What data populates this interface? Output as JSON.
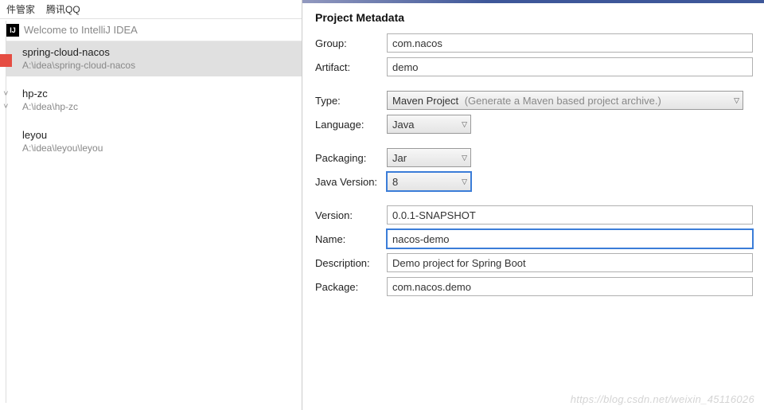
{
  "os_titlebar": {
    "item1": "件管家",
    "item2": "腾讯QQ"
  },
  "welcome": {
    "icon_text": "IJ",
    "title": "Welcome to IntelliJ IDEA"
  },
  "projects": [
    {
      "name": "spring-cloud-nacos",
      "path": "A:\\idea\\spring-cloud-nacos",
      "selected": true
    },
    {
      "name": "hp-zc",
      "path": "A:\\idea\\hp-zc",
      "selected": false
    },
    {
      "name": "leyou",
      "path": "A:\\idea\\leyou\\leyou",
      "selected": false
    }
  ],
  "sidebar_stub": {
    "text1": ">",
    "text2": ">"
  },
  "metadata": {
    "section_title": "Project Metadata",
    "labels": {
      "group": "Group:",
      "artifact": "Artifact:",
      "type": "Type:",
      "language": "Language:",
      "packaging": "Packaging:",
      "javaVersion": "Java Version:",
      "version": "Version:",
      "name": "Name:",
      "description": "Description:",
      "pkg": "Package:"
    },
    "values": {
      "group": "com.nacos",
      "artifact": "demo",
      "type": "Maven Project",
      "type_hint": "(Generate a Maven based project archive.)",
      "language": "Java",
      "packaging": "Jar",
      "javaVersion": "8",
      "version": "0.0.1-SNAPSHOT",
      "name": "nacos-demo",
      "description": "Demo project for Spring Boot",
      "pkg": "com.nacos.demo"
    }
  },
  "watermark": "https://blog.csdn.net/weixin_45116026"
}
